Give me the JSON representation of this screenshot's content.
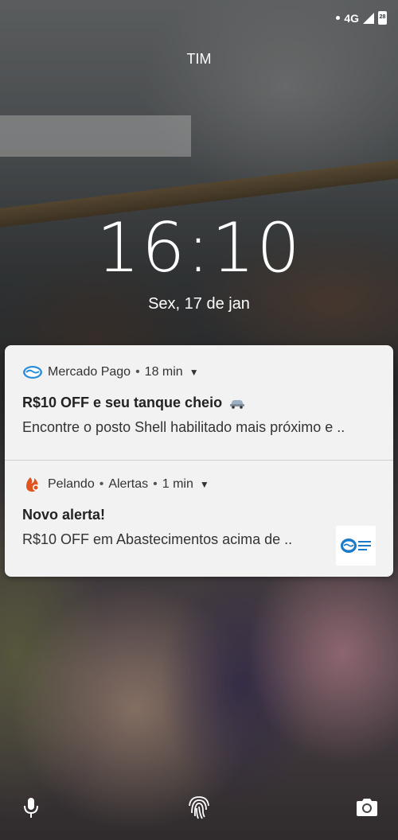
{
  "status": {
    "network": "4G",
    "battery": "28"
  },
  "lockscreen": {
    "carrier": "TIM",
    "time": "16:10",
    "date": "Sex, 17 de jan"
  },
  "notifications": [
    {
      "app": "Mercado Pago",
      "separator": "•",
      "age": "18 min",
      "title": "R$10 OFF e seu tanque cheio",
      "text": "Encontre o posto Shell habilitado mais próximo e ..",
      "icon": "mercado-pago-icon",
      "accent": "#2a8fd8"
    },
    {
      "app": "Pelando",
      "separator": "•",
      "channel": "Alertas",
      "separator2": "•",
      "age": "1 min",
      "title": "Novo alerta!",
      "text": "R$10 OFF em Abastecimentos acima de ..",
      "icon": "pelando-icon",
      "accent": "#e0541f",
      "thumbnail_text": "mercado pago"
    }
  ],
  "bottom_shortcuts": [
    "microphone-icon",
    "fingerprint-icon",
    "camera-icon"
  ]
}
